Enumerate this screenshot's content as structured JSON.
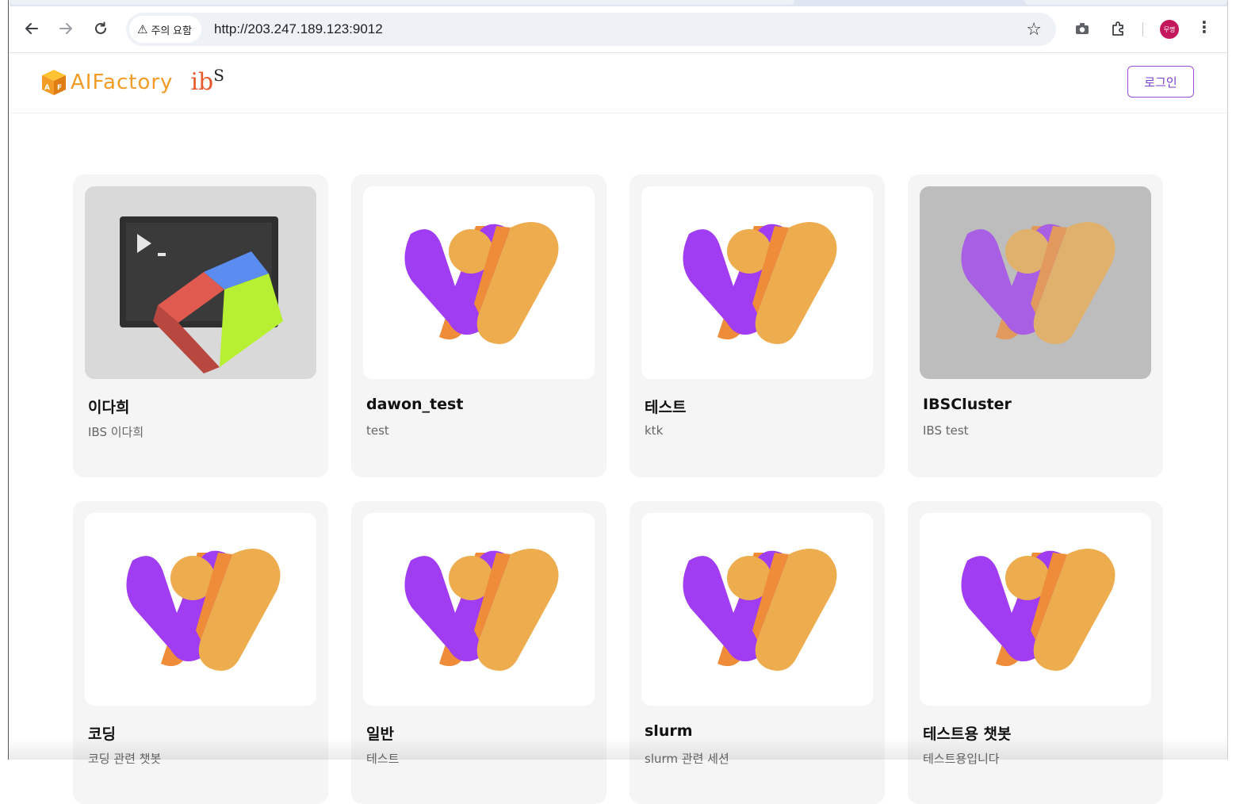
{
  "browser": {
    "security_label": "주의 요함",
    "url": "http://203.247.189.123:9012",
    "profile_initials": "무명"
  },
  "site": {
    "brand_name": "AIFactory",
    "partner_logo_text": "ib",
    "partner_logo_sup": "S",
    "login_label": "로그인",
    "brand_color": "#f29b26",
    "accent_color": "#9b4dd6"
  },
  "cards": [
    {
      "title": "이다희",
      "desc": "IBS 이다희",
      "thumb": "terminal-icon"
    },
    {
      "title": "dawon_test",
      "desc": "test",
      "thumb": "w-logo"
    },
    {
      "title": "테스트",
      "desc": "ktk",
      "thumb": "w-logo"
    },
    {
      "title": "IBSCluster",
      "desc": "IBS test",
      "thumb": "w-logo-dimmed"
    },
    {
      "title": "코딩",
      "desc": "코딩 관련 챗봇",
      "thumb": "w-logo"
    },
    {
      "title": "일반",
      "desc": "테스트",
      "thumb": "w-logo"
    },
    {
      "title": "slurm",
      "desc": "slurm 관련 세션",
      "thumb": "w-logo"
    },
    {
      "title": "테스트용 챗봇",
      "desc": "테스트용입니다",
      "thumb": "w-logo"
    }
  ]
}
